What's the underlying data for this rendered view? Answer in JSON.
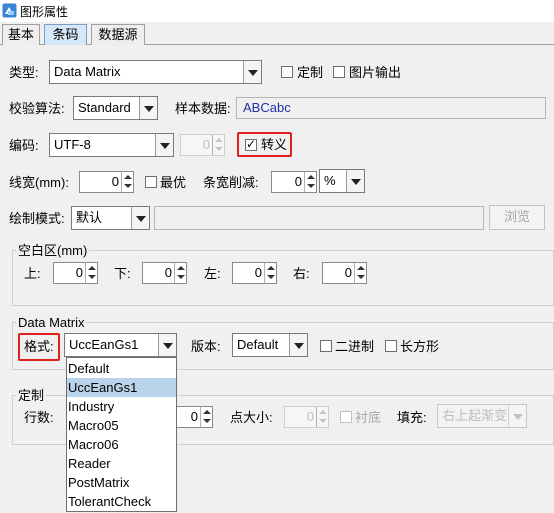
{
  "window": {
    "title": "图形属性"
  },
  "tabs": [
    {
      "label": "基本",
      "active": false
    },
    {
      "label": "条码",
      "active": true
    },
    {
      "label": "数据源",
      "active": false
    }
  ],
  "type_row": {
    "label": "类型:",
    "value": "Data Matrix",
    "custom_label": "定制",
    "custom_checked": false,
    "image_output_label": "图片输出",
    "image_output_checked": false
  },
  "check_row": {
    "label": "校验算法:",
    "value": "Standard",
    "sample_label": "样本数据:",
    "sample_value": "ABCabc"
  },
  "encoding_row": {
    "label": "编码:",
    "value": "UTF-8",
    "spin_value": "0",
    "escape_label": "转义",
    "escape_checked": true
  },
  "width_row": {
    "label": "线宽(mm):",
    "value": "0",
    "optimal_label": "最优",
    "optimal_checked": false,
    "reduce_label": "条宽削减:",
    "reduce_value": "0",
    "reduce_unit": "%"
  },
  "draw_row": {
    "label": "绘制模式:",
    "value": "默认",
    "browse_label": "浏览"
  },
  "quiet_zone": {
    "legend": "空白区(mm)",
    "top_label": "上:",
    "top_value": "0",
    "bottom_label": "下:",
    "bottom_value": "0",
    "left_label": "左:",
    "left_value": "0",
    "right_label": "右:",
    "right_value": "0"
  },
  "datamatrix": {
    "legend": "Data Matrix",
    "format_label": "格式:",
    "format_value": "UccEanGs1",
    "version_label": "版本:",
    "version_value": "Default",
    "binary_label": "二进制",
    "binary_checked": false,
    "rectangle_label": "长方形",
    "rectangle_checked": false
  },
  "custom_group": {
    "legend": "定制",
    "rows_label": "行数:",
    "rows_value": "0",
    "dot_size_label": "点大小:",
    "dot_size_value": "0",
    "lining_label": "衬底",
    "lining_checked": false,
    "fill_label": "填充:",
    "fill_value": "右上起渐变"
  },
  "format_dropdown": {
    "options": [
      "Default",
      "UccEanGs1",
      "Industry",
      "Macro05",
      "Macro06",
      "Reader",
      "PostMatrix",
      "TolerantCheck"
    ],
    "selected": "UccEanGs1"
  },
  "colors": {
    "highlight_box": "#e0201c",
    "sample_text": "#1f2faa",
    "selected_option": "#b9d3ea",
    "active_tab": "#d6e7f7"
  }
}
